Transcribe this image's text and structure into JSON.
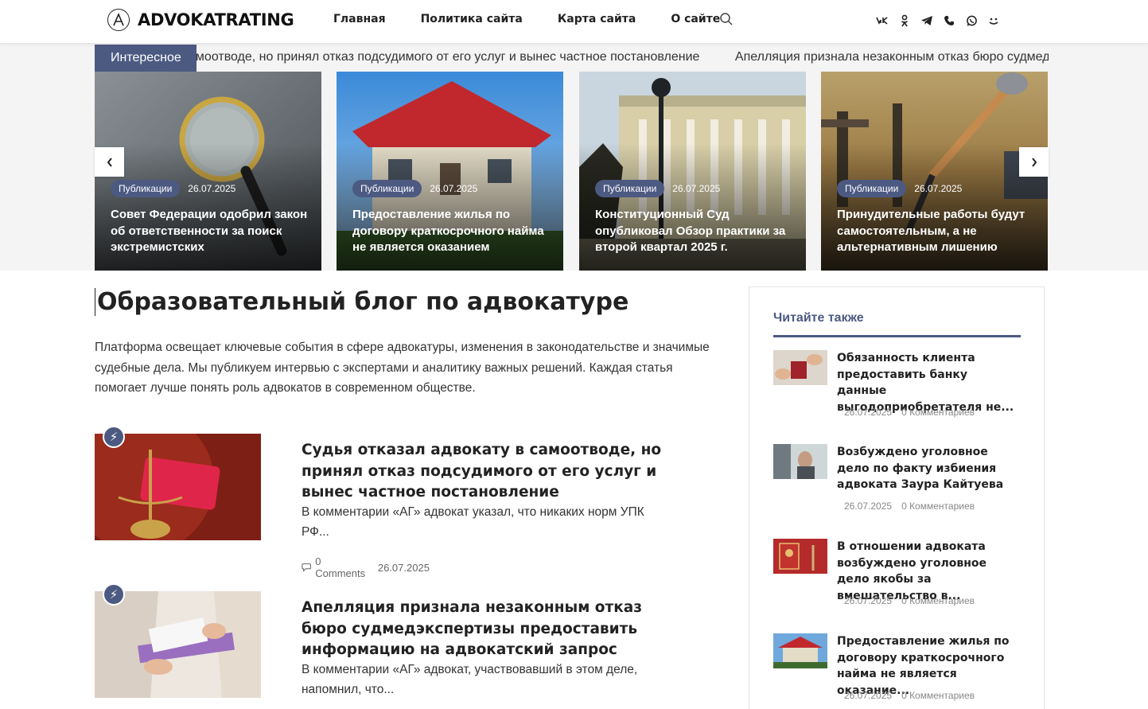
{
  "header": {
    "logo_text": "ADVOKATRATING",
    "nav": [
      "Главная",
      "Политика сайта",
      "Карта сайта",
      "О сайте"
    ],
    "socials": [
      "vk-icon",
      "odnoklassniki-icon",
      "telegram-icon",
      "viber-icon",
      "whatsapp-icon",
      "mail-icon"
    ]
  },
  "ticker": {
    "label": "Интересное",
    "items": [
      "Судья отказал адвокату в самоотводе, но принял отказ подсудимого от его услуг и вынес частное постановление",
      "Апелляция признала незаконным отказ бюро судмедэкспертизы предоставить информацию на адвокатский запрос"
    ]
  },
  "slider": {
    "cards": [
      {
        "category": "Публикации",
        "date": "26.07.2025",
        "title": "Совет Федерации одобрил закон об ответственности за поиск экстремистских"
      },
      {
        "category": "Публикации",
        "date": "26.07.2025",
        "title": "Предоставление жилья по договору краткосрочного найма не является оказанием"
      },
      {
        "category": "Публикации",
        "date": "26.07.2025",
        "title": "Конституционный Суд опубликовал Обзор практики за второй квартал 2025 г."
      },
      {
        "category": "Публикации",
        "date": "26.07.2025",
        "title": "Принудительные работы будут самостоятельным, а не альтернативным лишению"
      }
    ]
  },
  "main": {
    "title": "Образовательный блог по адвокатуре",
    "intro": "Платформа освещает ключевые события в сфере адвокатуры, изменения в законодательстве и значимые судебные дела. Мы публикуем интервью с экспертами и аналитику важных решений. Каждая статья помогает лучше понять роль адвокатов в современном обществе.",
    "posts": [
      {
        "title": "Судья отказал адвокату в самоотводе, но принял отказ подсудимого от его услуг и вынес частное постановление",
        "excerpt": "В комментарии «АГ» адвокат указал, что никаких норм УПК РФ...",
        "comments": "0 Comments",
        "date": "26.07.2025"
      },
      {
        "title": "Апелляция признала незаконным отказ бюро судмедэкспертизы предоставить информацию на адвокатский запрос",
        "excerpt": "В комментарии «АГ» адвокат, участвовавший в этом деле, напомнил, что...",
        "comments": "0 Comments",
        "date": "26.07.2025"
      }
    ]
  },
  "sidebar": {
    "title": "Читайте также",
    "items": [
      {
        "title": "Обязанность клиента предоставить банку данные выгодоприобретателя не...",
        "date": "26.07.2025",
        "comments": "0 Комментариев"
      },
      {
        "title": "Возбуждено уголовное дело по факту избиения адвоката Заура Кайтуева",
        "date": "26.07.2025",
        "comments": "0 Комментариев"
      },
      {
        "title": "В отношении адвоката возбуждено уголовное дело якобы за вмешательство в...",
        "date": "26.07.2025",
        "comments": "0 Комментариев"
      },
      {
        "title": "Предоставление жилья по договору краткосрочного найма не является оказание...",
        "date": "26.07.2025",
        "comments": "0 Комментариев"
      }
    ]
  },
  "colors": {
    "accent": "#4c5a82",
    "text": "#222222",
    "muted": "#888888"
  }
}
